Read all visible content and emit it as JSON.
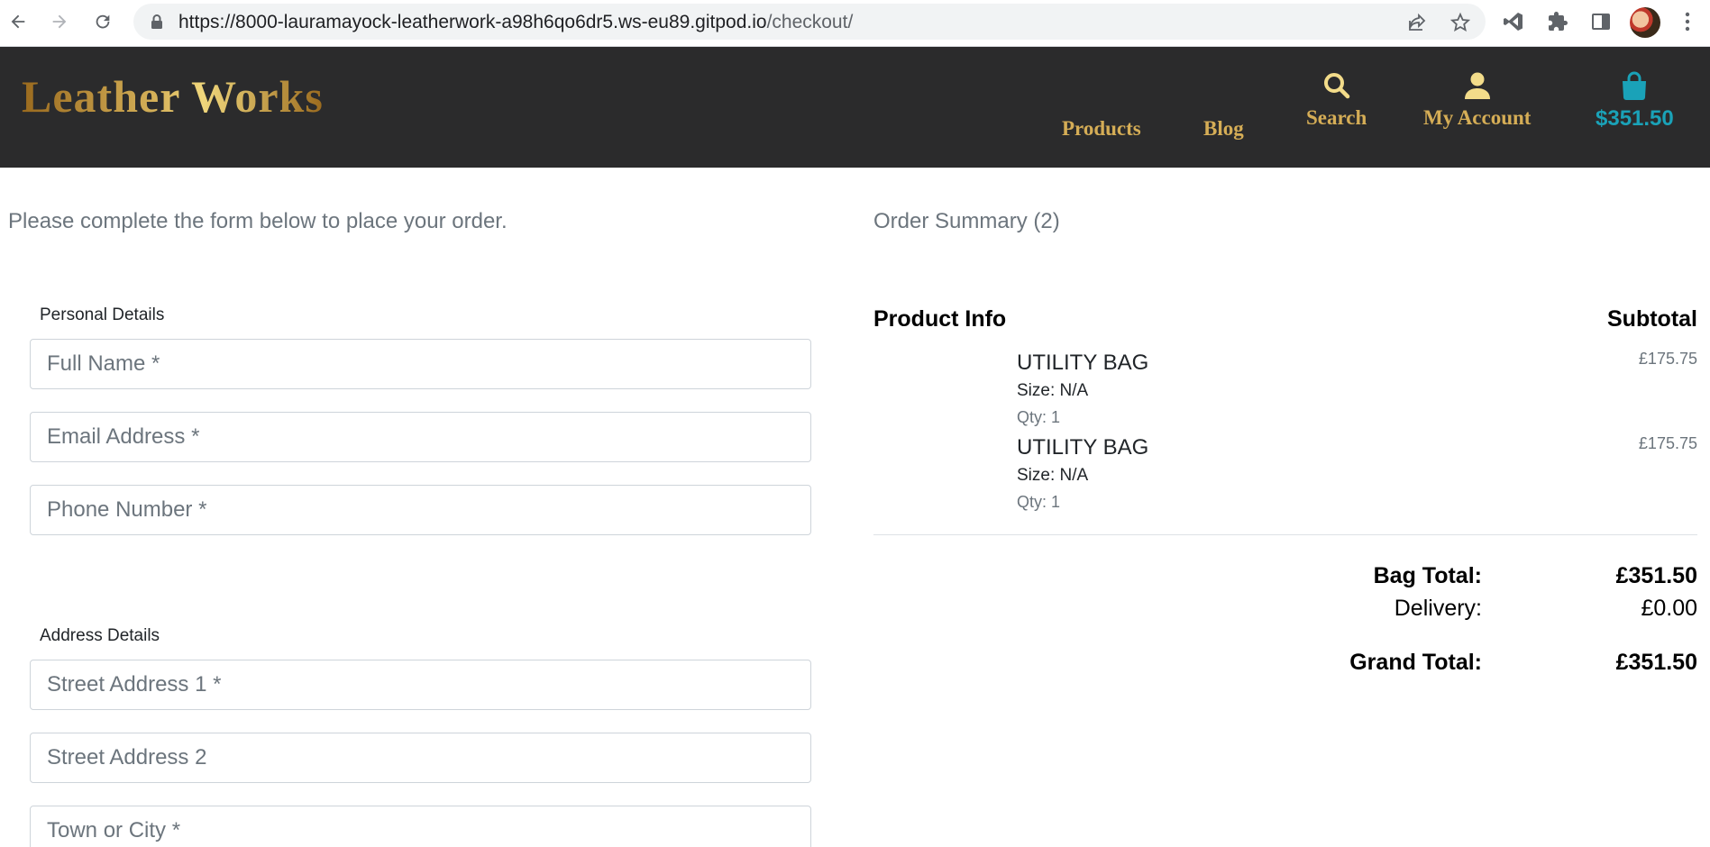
{
  "browser": {
    "url_host": "https://8000-lauramayock-leatherwork-a98h6qo6dr5.ws-eu89.gitpod.io",
    "url_path": "/checkout/",
    "icons": [
      "back-arrow-icon",
      "forward-arrow-icon",
      "reload-icon",
      "lock-icon",
      "share-icon",
      "star-icon",
      "vscode-icon",
      "puzzle-icon",
      "side-panel-icon",
      "kebab-menu-icon"
    ]
  },
  "header": {
    "logo": "Leather Works",
    "nav": {
      "products": "Products",
      "blog": "Blog",
      "search": "Search",
      "account": "My Account",
      "bag_total": "$351.50"
    },
    "colors": {
      "background": "#2b2b2c",
      "gold": "#d5ad56",
      "bag": "#1aa2b8"
    }
  },
  "checkout": {
    "intro": "Please complete the form below to place your order.",
    "personal_legend": "Personal Details",
    "full_name_placeholder": "Full Name *",
    "email_placeholder": "Email Address *",
    "phone_placeholder": "Phone Number *",
    "address_legend": "Address Details",
    "street1_placeholder": "Street Address 1 *",
    "street2_placeholder": "Street Address 2",
    "town_placeholder": "Town or City *"
  },
  "summary": {
    "heading": "Order Summary (2)",
    "col_product": "Product Info",
    "col_subtotal": "Subtotal",
    "items": [
      {
        "name": "UTILITY BAG",
        "size": "Size: N/A",
        "qty": "Qty: 1",
        "price": "£175.75"
      },
      {
        "name": "UTILITY BAG",
        "size": "Size: N/A",
        "qty": "Qty: 1",
        "price": "£175.75"
      }
    ],
    "bag_total_label": "Bag Total:",
    "bag_total_value": "£351.50",
    "delivery_label": "Delivery:",
    "delivery_value": "£0.00",
    "grand_total_label": "Grand Total:",
    "grand_total_value": "£351.50"
  }
}
